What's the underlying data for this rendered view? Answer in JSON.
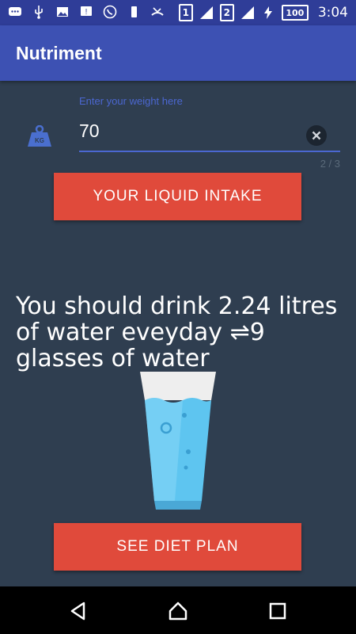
{
  "status_bar": {
    "sim1": "1",
    "sim2": "2",
    "battery": "100",
    "time": "3:04"
  },
  "app_bar": {
    "title": "Nutriment"
  },
  "weight_input": {
    "hint": "Enter your weight here",
    "value": "70",
    "counter": "2 / 3"
  },
  "liquid_button": {
    "label": "YOUR LIQUID INTAKE"
  },
  "result": {
    "text": "You should drink 2.24 litres of water eveyday ⇌9 glasses of water"
  },
  "diet_button": {
    "label": "SEE DIET PLAN"
  },
  "colors": {
    "app_bar": "#3d51b3",
    "status_bar": "#2f3d98",
    "background": "#2f3e50",
    "button": "#e04a3b",
    "accent": "#4b67d1"
  }
}
